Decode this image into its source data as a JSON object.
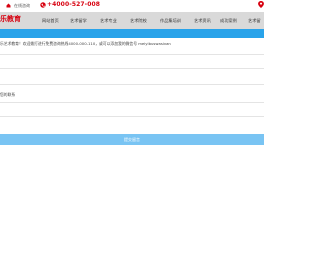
{
  "topbar": {
    "home_label": "在线咨询",
    "phone": "+4000-527-008"
  },
  "header": {
    "logo_text": "乐教育",
    "nav": [
      "网站首页",
      "艺术留学",
      "艺术专业",
      "艺术院校",
      "作品集培训",
      "艺术资讯",
      "成功案例",
      "艺术留"
    ]
  },
  "form": {
    "notice": "乐艺术教育！欢迎拨打进行免费咨询热线4000-000-110，或可以添加我的微信号 meiyibuswasivan",
    "label_2": "您的联系",
    "submit_label": "提交留言"
  },
  "colors": {
    "brand_red": "#d7000f",
    "accent_blue": "#29a3ea",
    "button_blue": "#79c4f3"
  }
}
